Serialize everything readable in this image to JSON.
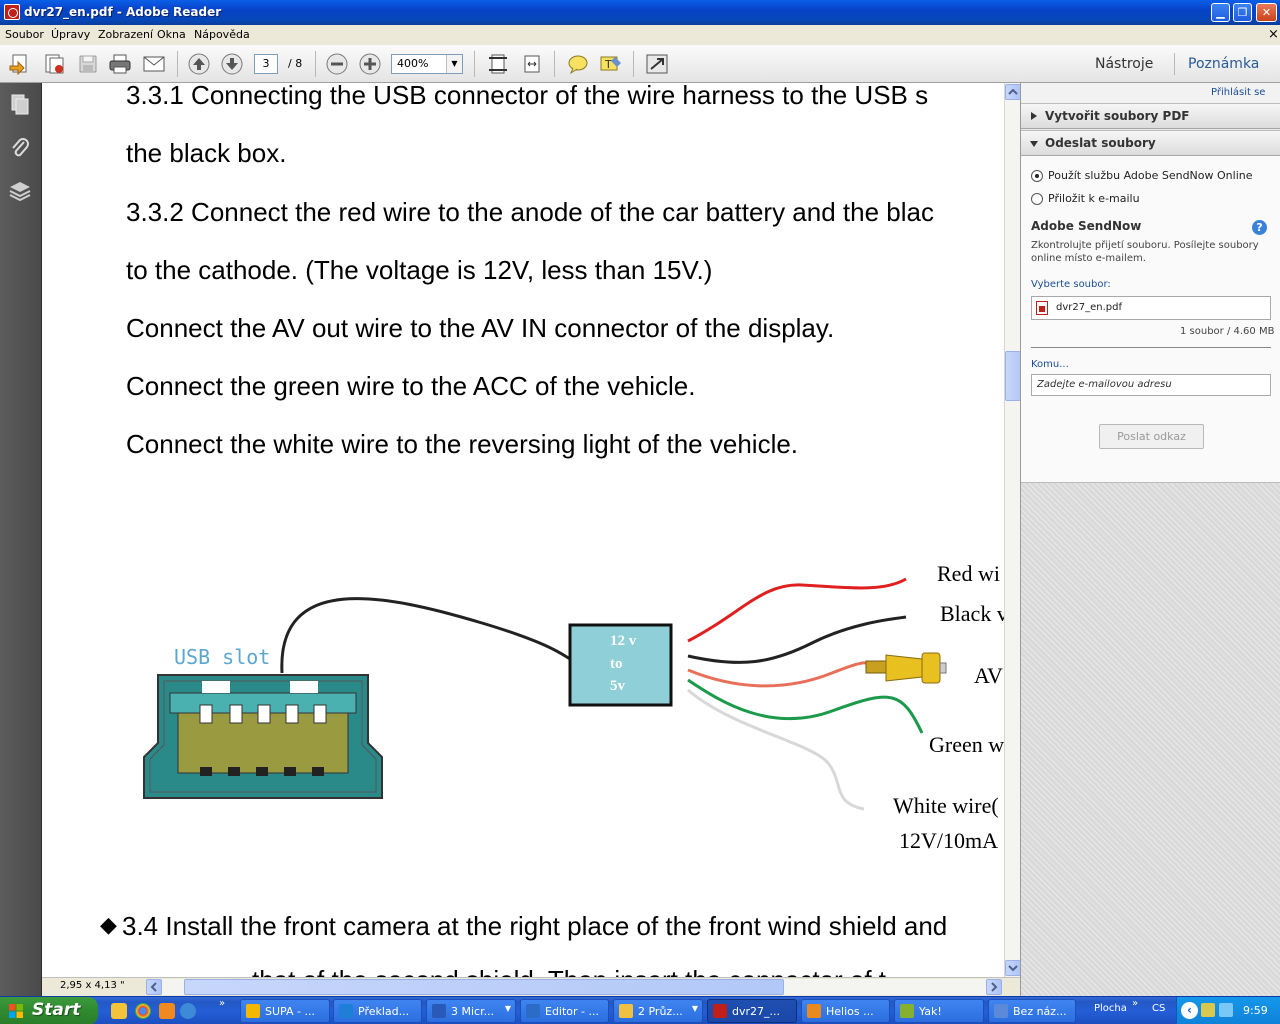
{
  "window": {
    "title": "dvr27_en.pdf - Adobe Reader"
  },
  "menu": [
    "Soubor",
    "Úpravy",
    "Zobrazení",
    "Okna",
    "Nápověda"
  ],
  "toolbar": {
    "page_current": "3",
    "page_total": "/ 8",
    "zoom": "400%",
    "tools_label": "Nástroje",
    "comment_label": "Poznámka"
  },
  "document": {
    "lines": [
      " 3.3.1 Connecting the USB connector of the wire harness to the USB s",
      "the black box.",
      "3.3.2 Connect the red wire to the anode of the car battery and the blac",
      "to the cathode. (The voltage is 12V, less than 15V.)",
      "Connect the AV out wire to the AV IN connector of the display.",
      "Connect the green wire to the ACC of the vehicle.",
      "Connect the white wire to the reversing light of the vehicle."
    ],
    "diagram": {
      "usb_label": "USB slot",
      "box_line1": "12 v",
      "box_line2": "to",
      "box_line3": "5v",
      "red_label": "Red wi",
      "black_label": "Black v",
      "av_label": "AV",
      "green_label": "Green w",
      "white_label": "White wire(",
      "white_sub": "12V/10mA",
      "wire_colors": {
        "red": "#e02020",
        "black": "#222222",
        "av": "#e8705a",
        "green": "#1a9a4a",
        "white": "#d8d8d8"
      }
    },
    "section_34": "3.4 Install the front camera at the right place of the front wind shield and",
    "bullet": "◆",
    "next_line_partial": "that of the second shield. Then insert the connector of t"
  },
  "status": {
    "page_size": "2,95 x 4,13 \""
  },
  "right_pane": {
    "login_link": "Přihlásit se",
    "section_create": "Vytvořit soubory PDF",
    "section_send": "Odeslat soubory",
    "radio_sendnow": "Použít službu Adobe SendNow Online",
    "radio_email": "Přiložit k e-mailu",
    "sendnow_title": "Adobe SendNow",
    "sendnow_desc_1": "Zkontrolujte přijetí souboru. Posílejte soubory",
    "sendnow_desc_2": "online místo e-mailem.",
    "select_file_label": "Vyberte soubor:",
    "file_name": "dvr27_en.pdf",
    "file_info": "1 soubor / 4.60 MB",
    "to_label": "Komu...",
    "email_placeholder": "Zadejte e-mailovou adresu",
    "send_link_button": "Poslat odkaz"
  },
  "taskbar": {
    "start": "Start",
    "tasks": [
      {
        "label": "SUPA - ...",
        "icon_color": "#f5b800"
      },
      {
        "label": "Překlad...",
        "icon_color": "#1e7fd8"
      },
      {
        "label": "3 Micr...",
        "icon_color": "#2a5ab8"
      },
      {
        "label": "Editor - ...",
        "icon_color": "#2b6cc6"
      },
      {
        "label": "2 Průz...",
        "icon_color": "#f0c040"
      },
      {
        "label": "dvr27_...",
        "icon_color": "#c0201a"
      },
      {
        "label": "Helios ...",
        "icon_color": "#e88a20"
      },
      {
        "label": "Yak!",
        "icon_color": "#88b030"
      },
      {
        "label": "Bez náz...",
        "icon_color": "#5a8ad8"
      }
    ],
    "desktop_label": "Plocha",
    "lang": "CS",
    "clock": "9:59"
  }
}
